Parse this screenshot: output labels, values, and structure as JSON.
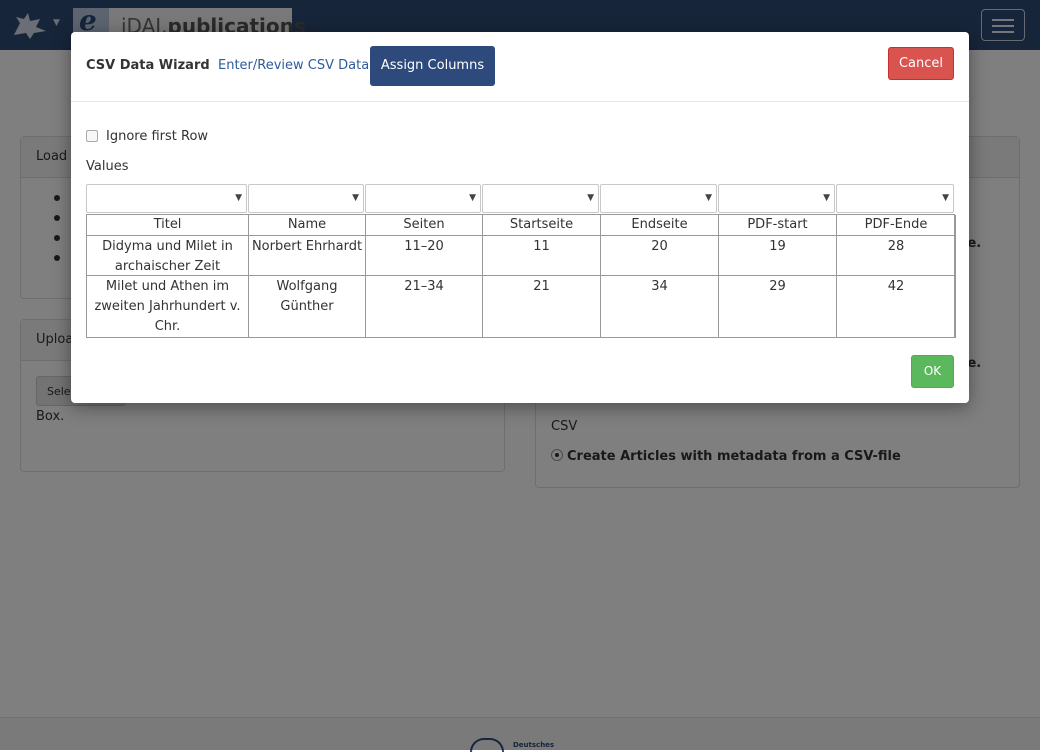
{
  "navbar": {
    "brand_prefix": "iDAI.",
    "brand_suffix": "publications",
    "brand_icon_letter": "e",
    "logo_icon": "griffin-logo-icon",
    "menu_icon": "hamburger-icon",
    "colors": {
      "bar": "#2e4a75"
    }
  },
  "background": {
    "panel_left_1_title": "Load l",
    "panel_left_2_title": "Uploa",
    "select_button": "Selec",
    "box_text": "Box.",
    "right_fragment_1": "le.",
    "right_fragment_2": "le.",
    "csv_label": "CSV",
    "csv_option": "Create Articles with metadata from a CSV-file",
    "footer_text": "Deutsches"
  },
  "modal": {
    "title": "CSV Data Wizard",
    "step_enter": "Enter/Review CSV Data",
    "step_assign": "Assign Columns",
    "cancel": "Cancel",
    "ignore_first_row": "Ignore first Row",
    "values_label": "Values",
    "ok": "OK",
    "colors": {
      "primary": "#2e4a7d",
      "danger": "#d9534f",
      "success": "#5cb85c",
      "link": "#2e5c9a"
    }
  },
  "table": {
    "headers": [
      "Titel",
      "Name",
      "Seiten",
      "Startseite",
      "Endseite",
      "PDF-start",
      "PDF-Ende"
    ],
    "rows": [
      [
        "Didyma und Milet in archaischer Zeit",
        "Norbert Ehrhardt",
        "11–20",
        "11",
        "20",
        "19",
        "28"
      ],
      [
        "Milet und Athen im zweiten Jahrhundert v. Chr.",
        "Wolfgang Günther",
        "21–34",
        "21",
        "34",
        "29",
        "42"
      ]
    ]
  }
}
